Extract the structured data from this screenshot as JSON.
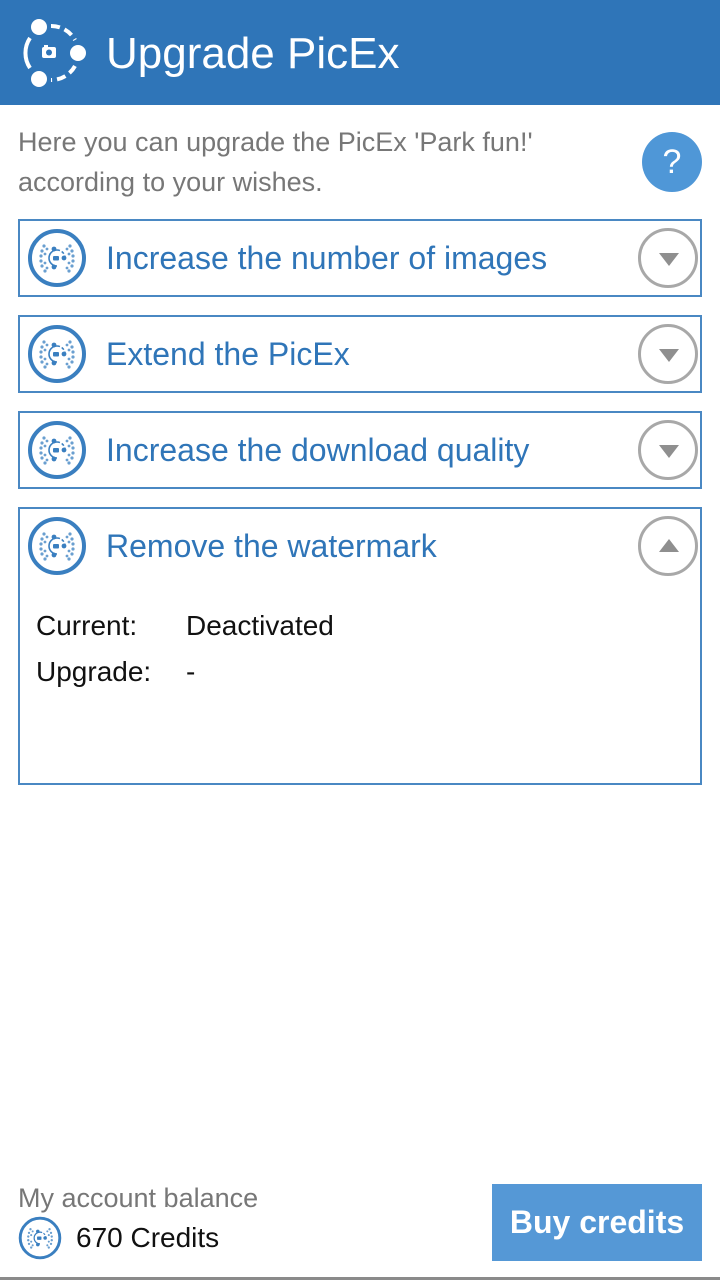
{
  "header": {
    "title": "Upgrade PicEx",
    "logo_icon": "picex-logo-icon"
  },
  "intro": {
    "text": "Here you can upgrade the PicEx 'Park fun!' according to your wishes.",
    "help_label": "?"
  },
  "panels": [
    {
      "label": "Increase the number of images",
      "expanded": false,
      "toggle_icon": "chevron-down-icon"
    },
    {
      "label": "Extend the PicEx",
      "expanded": false,
      "toggle_icon": "chevron-down-icon"
    },
    {
      "label": "Increase the download quality",
      "expanded": false,
      "toggle_icon": "chevron-down-icon"
    },
    {
      "label": "Remove the watermark",
      "expanded": true,
      "toggle_icon": "chevron-up-icon",
      "details": [
        {
          "key": "Current:",
          "value": "Deactivated"
        },
        {
          "key": "Upgrade:",
          "value": "-"
        }
      ]
    }
  ],
  "footer": {
    "balance_label": "My account balance",
    "balance_value": "670 Credits",
    "buy_label": "Buy credits"
  },
  "colors": {
    "header_bg": "#2f75b8",
    "accent": "#2f75b8",
    "help_button": "#4f97d7",
    "buy_button": "#5598d6",
    "panel_border": "#4a88c3",
    "toggle_gray": "#a8a8a8"
  }
}
